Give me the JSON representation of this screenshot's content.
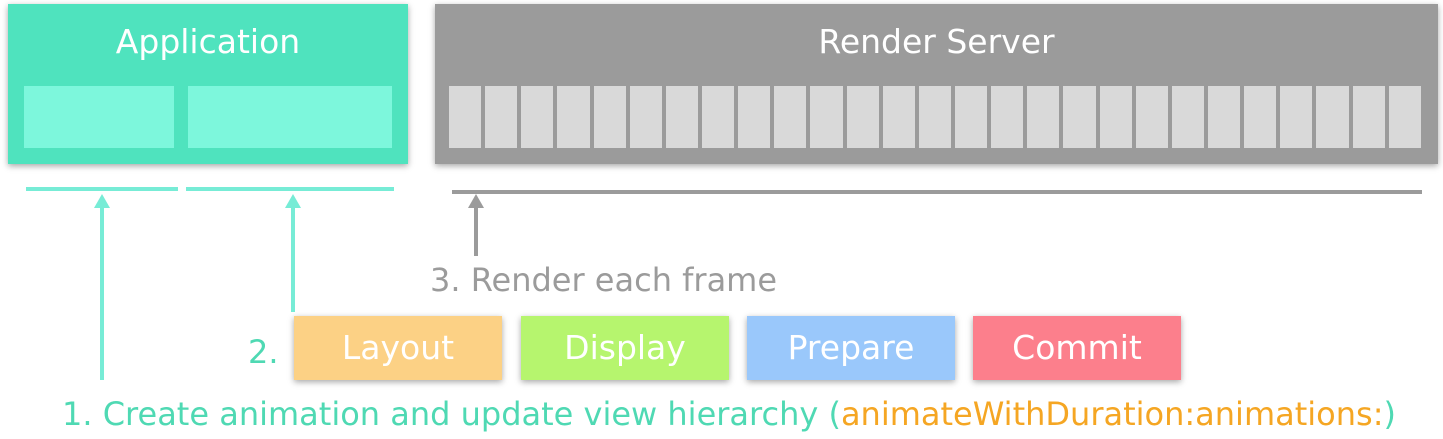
{
  "application": {
    "title": "Application",
    "color": "#4fe3be",
    "slot_color": "#7df7dc"
  },
  "render_server": {
    "title": "Render Server",
    "color": "#9b9b9b",
    "frame_color": "#d9d9d9",
    "frame_count": 27
  },
  "steps": {
    "step1_label": "1. Create animation and update view hierarchy (",
    "step1_method": "animateWithDuration:animations:",
    "step1_close": ")",
    "step2_label": "2.",
    "step3_label": "3. Render each frame"
  },
  "phases": [
    {
      "label": "Layout",
      "color": "#fcd185"
    },
    {
      "label": "Display",
      "color": "#b6f56e"
    },
    {
      "label": "Prepare",
      "color": "#9ac8fb"
    },
    {
      "label": "Commit",
      "color": "#fc7f8c"
    }
  ],
  "colors": {
    "teal_text": "#4fd9b3",
    "gray_text": "#9b9b9b",
    "orange_text": "#f5a623",
    "teal_line": "#77ecd6",
    "gray_line": "#9b9b9b"
  }
}
